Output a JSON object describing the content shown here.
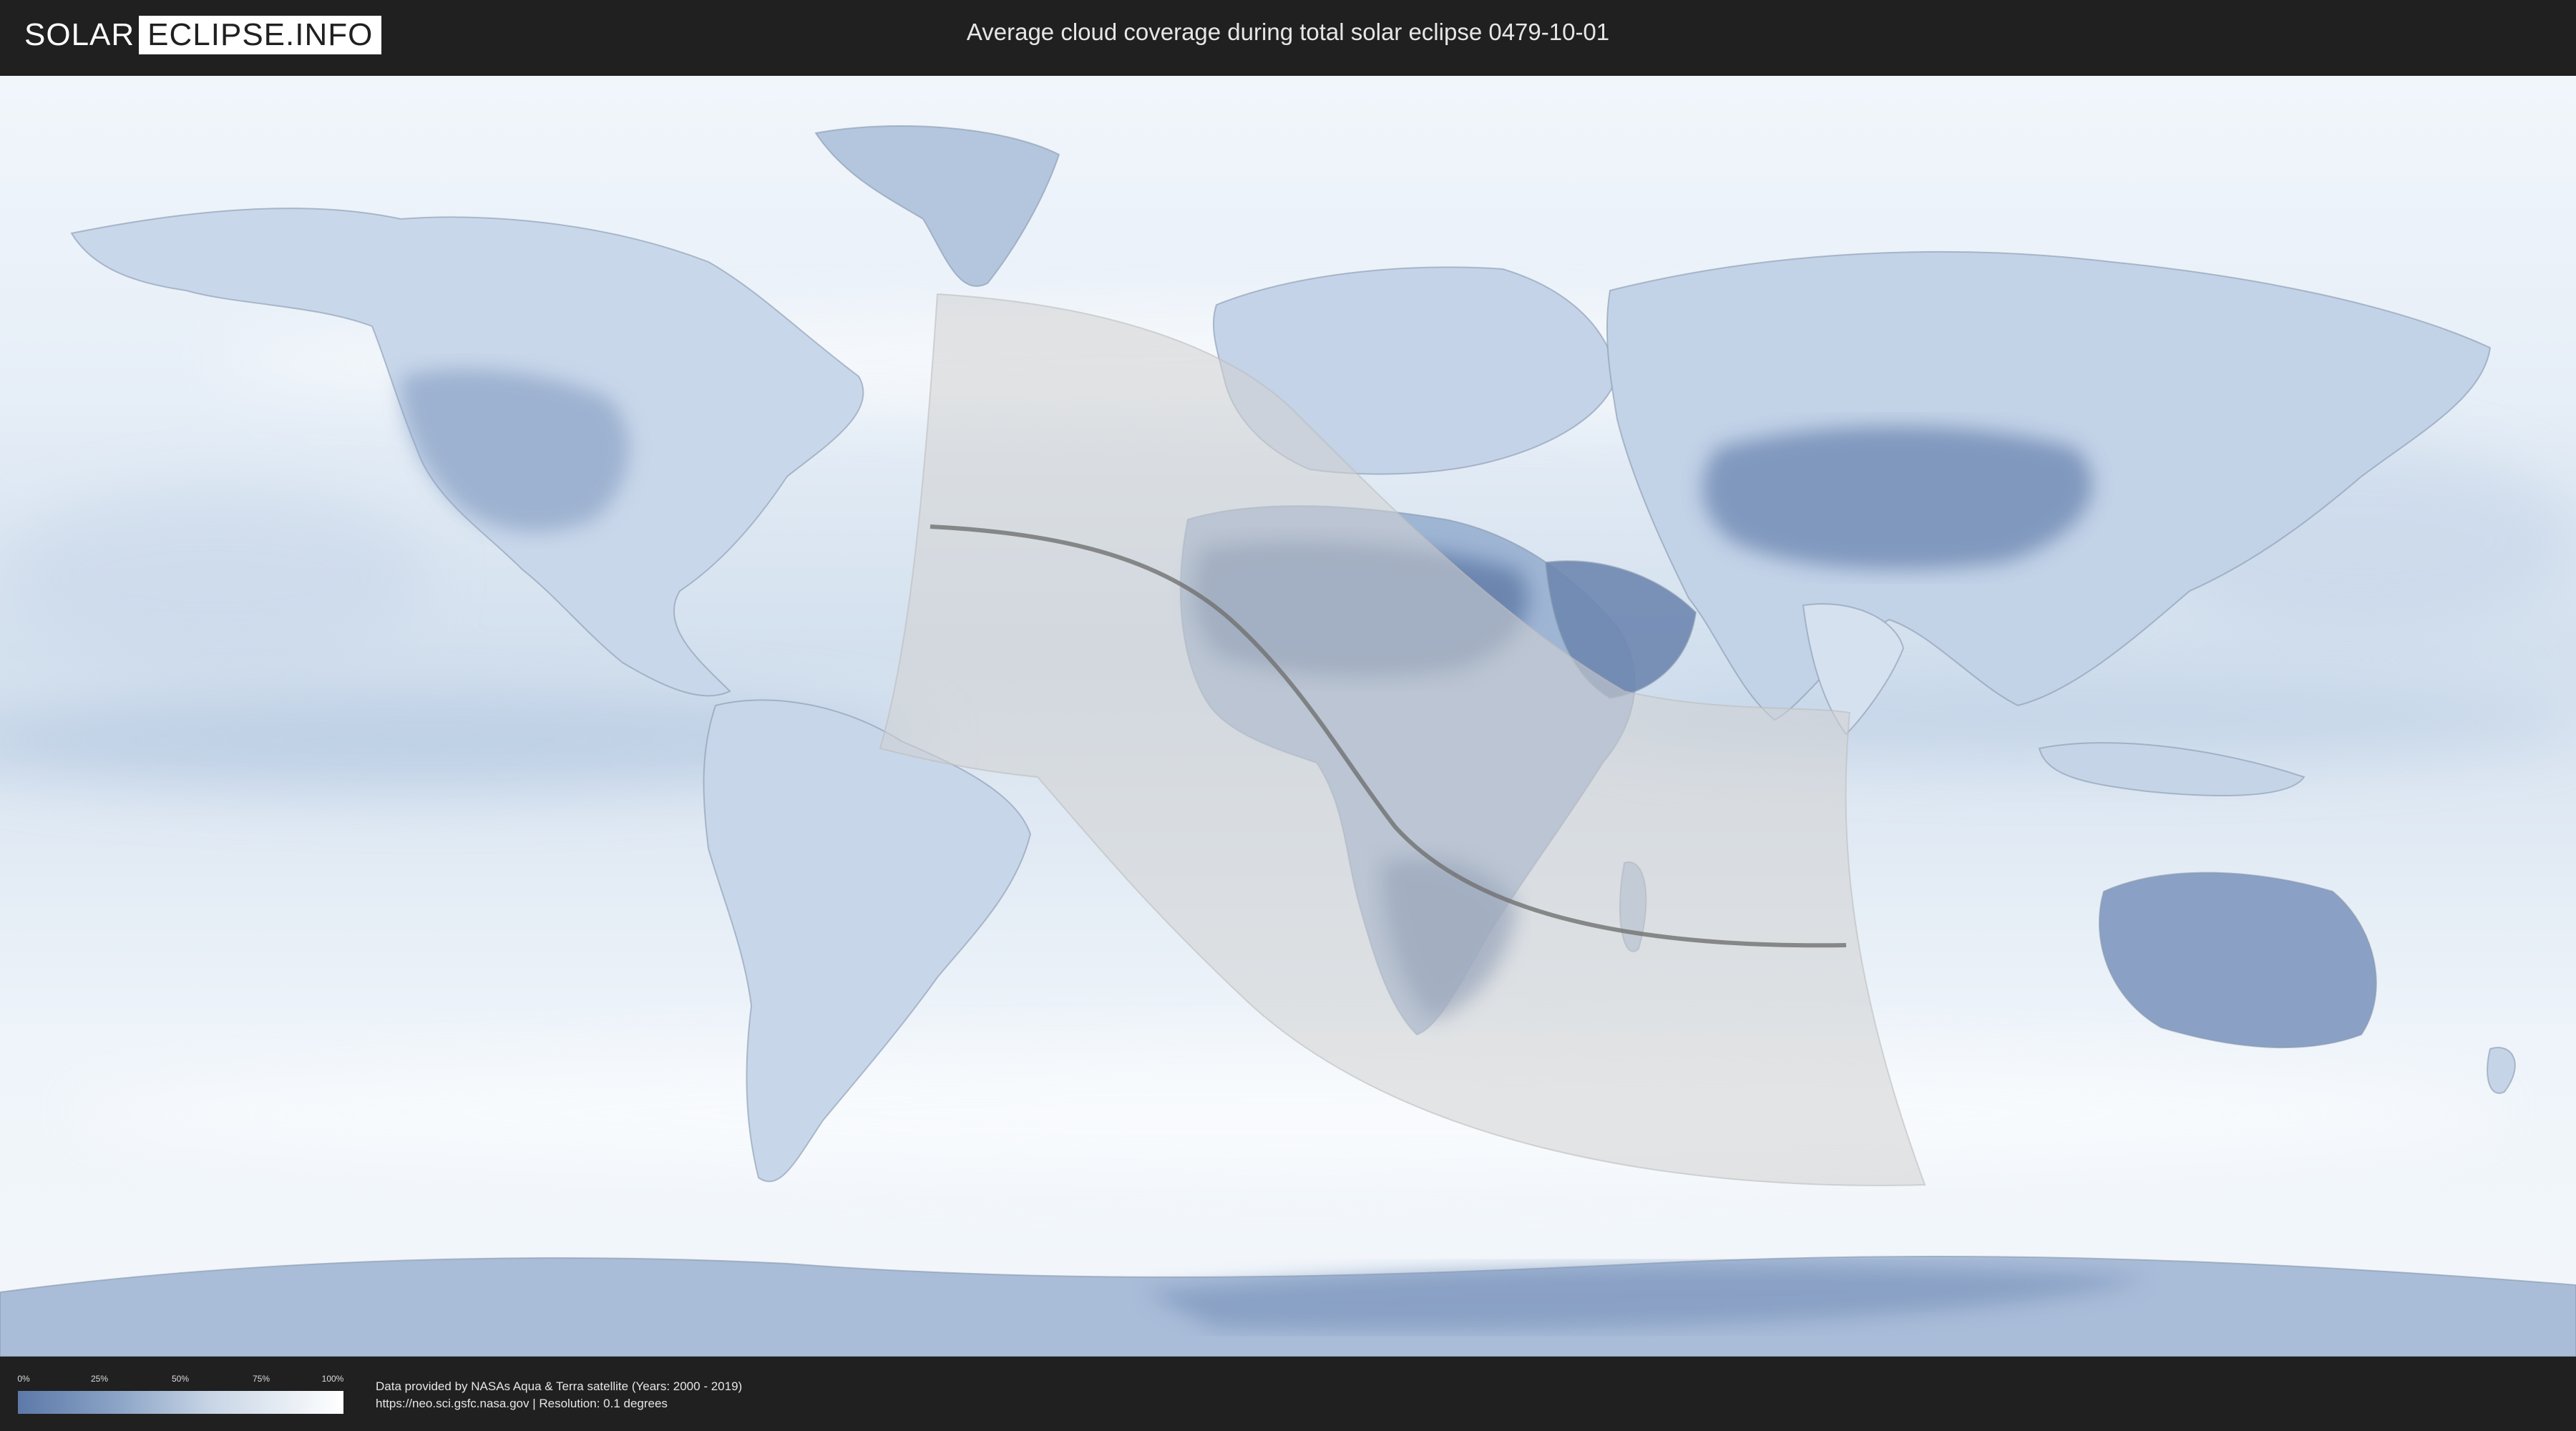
{
  "header": {
    "logo_left": "SOLAR",
    "logo_right": "ECLIPSE.INFO",
    "title": "Average cloud coverage during total solar eclipse 0479-10-01"
  },
  "legend": {
    "ticks": [
      "0%",
      "25%",
      "50%",
      "75%",
      "100%"
    ],
    "colors": {
      "low": "#5c79a8",
      "high": "#ffffff"
    }
  },
  "footer": {
    "line1": "Data provided by NASAs Aqua & Terra satellite (Years: 2000 - 2019)",
    "line2": "https://neo.sci.gsfc.nasa.gov | Resolution: 0.1 degrees"
  },
  "colors": {
    "background": "#202020",
    "map_cloud": "#eef4fa",
    "map_clear": "#5c79a8",
    "eclipse_shadow": "#d2d2d2",
    "central_line": "#707070"
  }
}
